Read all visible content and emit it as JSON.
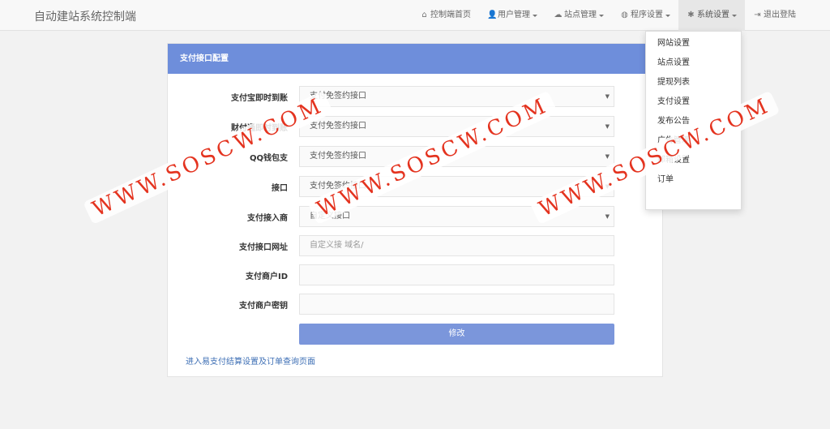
{
  "navbar": {
    "brand": "自动建站系统控制端",
    "items": [
      {
        "label": "控制端首页",
        "icon": "home-icon",
        "glyph": "⌂",
        "dropdown": false
      },
      {
        "label": "用户管理",
        "icon": "user-icon",
        "glyph": "👤",
        "dropdown": true
      },
      {
        "label": "站点管理",
        "icon": "cloud-icon",
        "glyph": "☁",
        "dropdown": true
      },
      {
        "label": "程序设置",
        "icon": "globe-icon",
        "glyph": "◍",
        "dropdown": true
      },
      {
        "label": "系统设置",
        "icon": "asterisk-icon",
        "glyph": "✱",
        "dropdown": true
      },
      {
        "label": "退出登陆",
        "icon": "logout-icon",
        "glyph": "⇥",
        "dropdown": false
      }
    ]
  },
  "dropdown": {
    "items": [
      "网站设置",
      "站点设置",
      "提现列表",
      "支付设置",
      "发布公告",
      "广告管理",
      "邮箱设置",
      "订单"
    ]
  },
  "panel": {
    "title": "支付接口配置",
    "fields": [
      {
        "label": "支付宝即时到账",
        "type": "select",
        "value": "支付免签约接口"
      },
      {
        "label": "财付通即时到账",
        "type": "select",
        "value": "支付免签约接口"
      },
      {
        "label": "QQ钱包支",
        "type": "select",
        "value": "支付免签约接口"
      },
      {
        "label": "接口",
        "type": "select",
        "value": "支付免签约接口"
      },
      {
        "label": "支付接入商",
        "type": "select",
        "value": "自定义接口"
      },
      {
        "label": "支付接口网址",
        "type": "input",
        "value": "",
        "placeholder": "自定义接 域名/"
      },
      {
        "label": "支付商户ID",
        "type": "input",
        "value": "",
        "placeholder": ""
      },
      {
        "label": "支付商户密钥",
        "type": "input",
        "value": "",
        "placeholder": ""
      }
    ],
    "submit_label": "修改",
    "link_text": "进入易支付结算设置及订单查询页面"
  },
  "watermark": {
    "text": "WWW.SOSCW.COM",
    "color": "#e4331f"
  },
  "colors": {
    "panel_heading": "#6e8edb",
    "submit": "#7b96db",
    "link": "#3e6fb5"
  }
}
